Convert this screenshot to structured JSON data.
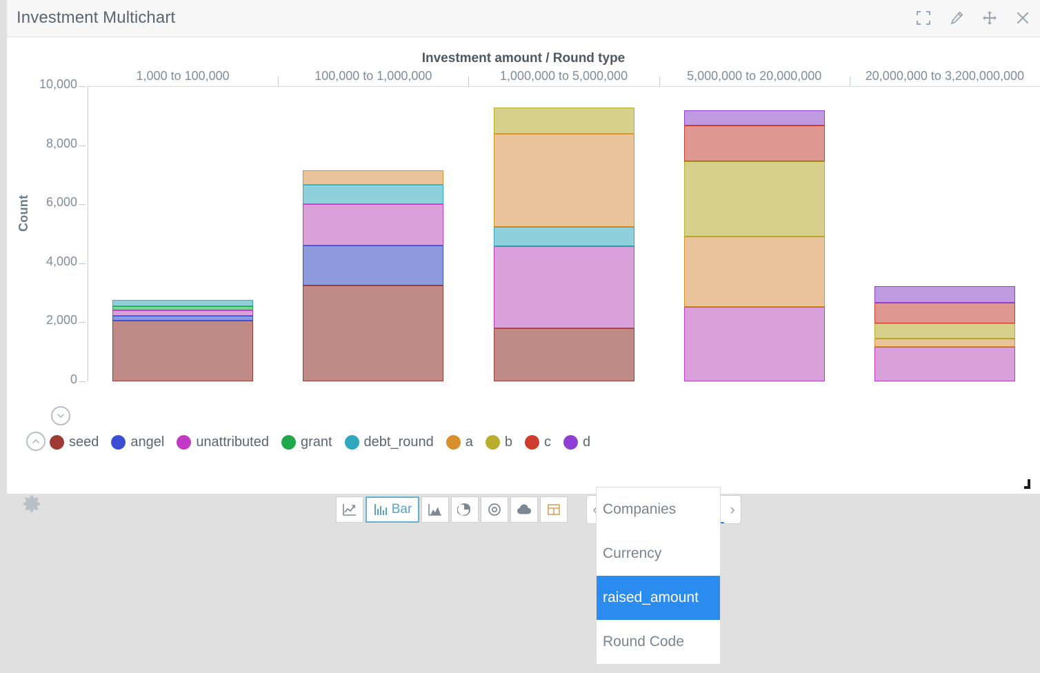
{
  "window": {
    "title": "Investment Multichart",
    "header_icons": [
      {
        "name": "fullscreen-icon",
        "label": "Fullscreen"
      },
      {
        "name": "edit-icon",
        "label": "Edit"
      },
      {
        "name": "move-icon",
        "label": "Move"
      },
      {
        "name": "close-icon",
        "label": "Close"
      }
    ]
  },
  "controls": {
    "collapse_down_label": "chevron-down",
    "collapse_up_label": "chevron-up",
    "settings_label": "gear",
    "toolbar": [
      {
        "id": "line",
        "label": "",
        "icon": "line-chart-icon",
        "active": false
      },
      {
        "id": "bar",
        "label": "Bar",
        "icon": "bar-chart-icon",
        "active": true
      },
      {
        "id": "area",
        "label": "",
        "icon": "area-chart-icon",
        "active": false
      },
      {
        "id": "pie",
        "label": "",
        "icon": "pie-chart-icon",
        "active": false
      },
      {
        "id": "radial",
        "label": "",
        "icon": "target-icon",
        "active": false
      },
      {
        "id": "cloud",
        "label": "",
        "icon": "cloud-icon",
        "active": false
      },
      {
        "id": "table",
        "label": "",
        "icon": "table-icon",
        "active": false
      }
    ],
    "field_selector": {
      "value": "raised_amount",
      "prev_label": "‹",
      "next_label": "›",
      "caret": "▼",
      "options": [
        {
          "label": "Companies",
          "selected": false
        },
        {
          "label": "Currency",
          "selected": false
        },
        {
          "label": "raised_amount",
          "selected": true
        },
        {
          "label": "Round Code",
          "selected": false
        }
      ]
    }
  },
  "chart_data": {
    "type": "bar",
    "stacked": true,
    "title": "Investment amount / Round type",
    "xlabel": "",
    "ylabel": "Count",
    "ylim": [
      0,
      10000
    ],
    "yticks": [
      "0",
      "2,000",
      "4,000",
      "6,000",
      "8,000",
      "10,000"
    ],
    "ytick_values": [
      0,
      2000,
      4000,
      6000,
      8000,
      10000
    ],
    "grid": false,
    "legend_position": "bottom",
    "categories": [
      "1,000 to 100,000",
      "100,000 to 1,000,000",
      "1,000,000 to 5,000,000",
      "5,000,000 to 20,000,000",
      "20,000,000 to 3,200,000,000"
    ],
    "series": [
      {
        "name": "seed",
        "color": "#c08a87",
        "border": "#9e3a34",
        "values": [
          2060,
          3250,
          1800,
          0,
          0
        ]
      },
      {
        "name": "angel",
        "color": "#8d9bdd",
        "border": "#3b4ed2",
        "values": [
          170,
          1350,
          0,
          0,
          0
        ]
      },
      {
        "name": "unattributed",
        "color": "#d9a0da",
        "border": "#c239c5",
        "values": [
          180,
          1400,
          2790,
          2520,
          1180
        ]
      },
      {
        "name": "grant",
        "color": "#7fd09b",
        "border": "#1fa84a",
        "values": [
          145,
          0,
          0,
          0,
          0
        ]
      },
      {
        "name": "debt_round",
        "color": "#8fd0db",
        "border": "#2fa8c0",
        "values": [
          195,
          650,
          640,
          0,
          0
        ]
      },
      {
        "name": "a",
        "color": "#e9c49a",
        "border": "#d98f2c",
        "values": [
          0,
          500,
          3150,
          2380,
          280
        ]
      },
      {
        "name": "b",
        "color": "#d6d08c",
        "border": "#b6ae2c",
        "values": [
          0,
          0,
          900,
          2550,
          500
        ]
      },
      {
        "name": "c",
        "color": "#dd9790",
        "border": "#cc3b2b",
        "values": [
          0,
          0,
          0,
          1230,
          700
        ]
      },
      {
        "name": "d",
        "color": "#c09ae0",
        "border": "#8e3fd6",
        "values": [
          0,
          0,
          0,
          500,
          560
        ]
      }
    ],
    "totals": [
      2750,
      7150,
      9280,
      9180,
      3220
    ]
  }
}
